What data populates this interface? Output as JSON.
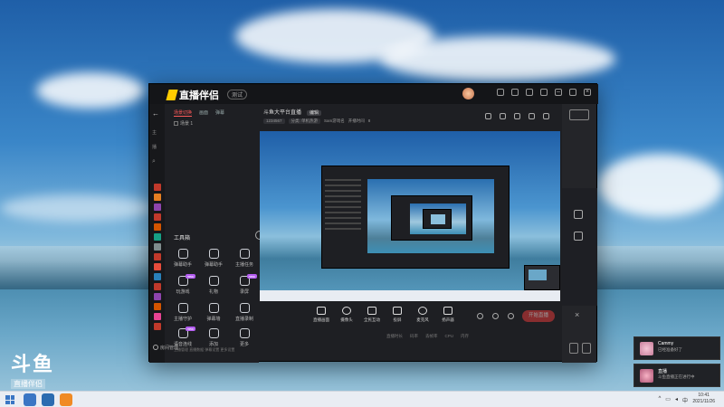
{
  "window": {
    "app_name": "直播伴侣",
    "version": "测试",
    "stream_title": "斗鱼大平台直播",
    "edit_label": "编辑",
    "meta_chips": [
      "1234567",
      "分类: 单机热游",
      "Sam游戏名",
      "开播时间",
      "8"
    ]
  },
  "left_panel": {
    "tabs": [
      "场景切换",
      "画面",
      "弹幕"
    ],
    "scene_label": "场景 1",
    "toolbox_title": "工具箱",
    "tools": [
      {
        "label": "弹幕助手",
        "tag": ""
      },
      {
        "label": "弹幕助手",
        "tag": ""
      },
      {
        "label": "主播任务",
        "tag": ""
      },
      {
        "label": "玩游戏",
        "tag": "new"
      },
      {
        "label": "礼物",
        "tag": ""
      },
      {
        "label": "录屏",
        "tag": "new"
      },
      {
        "label": "主播守护",
        "tag": ""
      },
      {
        "label": "弹幕墙",
        "tag": ""
      },
      {
        "label": "直播录制",
        "tag": ""
      },
      {
        "label": "语音连线",
        "tag": "new"
      },
      {
        "label": "添加",
        "tag": ""
      },
      {
        "label": "更多",
        "tag": ""
      }
    ],
    "bottom_text": [
      "主播管理",
      "直播数据",
      "弹幕设置",
      "更多设置"
    ],
    "footer": "房间管理"
  },
  "actions": [
    {
      "label": "直播画面",
      "icon": "screen-icon"
    },
    {
      "label": "摄像头",
      "icon": "camera-icon"
    },
    {
      "label": "全民互动",
      "icon": "interact-icon"
    },
    {
      "label": "投屏",
      "icon": "cast-icon"
    },
    {
      "label": "麦克风",
      "icon": "mic-icon"
    },
    {
      "label": "扬声器",
      "icon": "speaker-icon"
    }
  ],
  "start_button": "开始直播",
  "status_strip": [
    "直播时长",
    "码率",
    "丢帧率",
    "CPU",
    "内存"
  ],
  "notifications": [
    {
      "name": "Cammy",
      "message": "已经准备好了"
    },
    {
      "name": "直播",
      "message": "斗鱼直播正在进行中"
    }
  ],
  "watermark": {
    "logo": "斗鱼",
    "sub": "直播伴侣",
    "id": "2424464"
  },
  "taskbar": {
    "time": "10:41",
    "date": "2021/11/26"
  },
  "colors": {
    "accent": "#ff5a5a",
    "start_button": "#e03a3a",
    "window_bg": "#1e1f23"
  }
}
